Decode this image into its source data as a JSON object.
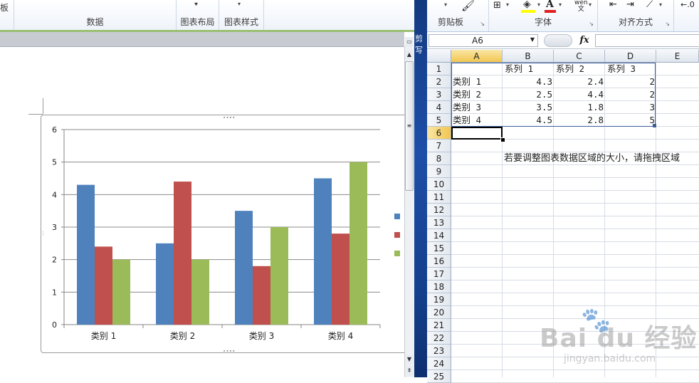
{
  "word": {
    "ribbon_groups": [
      {
        "label": "板",
        "x": 0
      },
      {
        "label": "数据",
        "x": 20
      },
      {
        "label": "图表布局",
        "x": 248
      },
      {
        "label": "图表样式",
        "x": 308
      }
    ]
  },
  "chart_data": {
    "type": "bar",
    "categories": [
      "类别 1",
      "类别 2",
      "类别 3",
      "类别 4"
    ],
    "series": [
      {
        "name": "系列 1",
        "values": [
          4.3,
          2.5,
          3.5,
          4.5
        ],
        "color": "#4f81bd"
      },
      {
        "name": "系列 2",
        "values": [
          2.4,
          4.4,
          1.8,
          2.8
        ],
        "color": "#c0504d"
      },
      {
        "name": "系列 3",
        "values": [
          2,
          2,
          3,
          5
        ],
        "color": "#9bbb59"
      }
    ],
    "yticks": [
      "0",
      "1",
      "2",
      "3",
      "4",
      "5",
      "6"
    ],
    "ylim": [
      0,
      6
    ],
    "grid": true,
    "legend": "right"
  },
  "excel": {
    "edge_glyphs": [
      "剪",
      "写"
    ],
    "ribbon_groups": [
      "剪贴板",
      "字体",
      "对齐方式"
    ],
    "name_box": "A6",
    "fx": "fx",
    "columns": [
      "A",
      "B",
      "C",
      "D",
      "E"
    ],
    "rows": [
      "1",
      "2",
      "3",
      "4",
      "5",
      "6",
      "7",
      "8",
      "9",
      "10",
      "11",
      "12",
      "13",
      "14",
      "15",
      "16",
      "17",
      "18",
      "19",
      "20",
      "21",
      "22",
      "23",
      "24",
      "25"
    ],
    "table": {
      "header": [
        "系列 1",
        "系列 2",
        "系列 3"
      ],
      "rows": [
        {
          "label": "类别 1",
          "values": [
            "4.3",
            "2.4",
            "2"
          ]
        },
        {
          "label": "类别 2",
          "values": [
            "2.5",
            "4.4",
            "2"
          ]
        },
        {
          "label": "类别 3",
          "values": [
            "3.5",
            "1.8",
            "3"
          ]
        },
        {
          "label": "类别 4",
          "values": [
            "4.5",
            "2.8",
            "5"
          ]
        }
      ]
    },
    "note": "若要调整图表数据区域的大小，请拖拽区域"
  },
  "watermark": {
    "brand": "Bai du 经验",
    "url": "jingyan.baidu.com"
  }
}
